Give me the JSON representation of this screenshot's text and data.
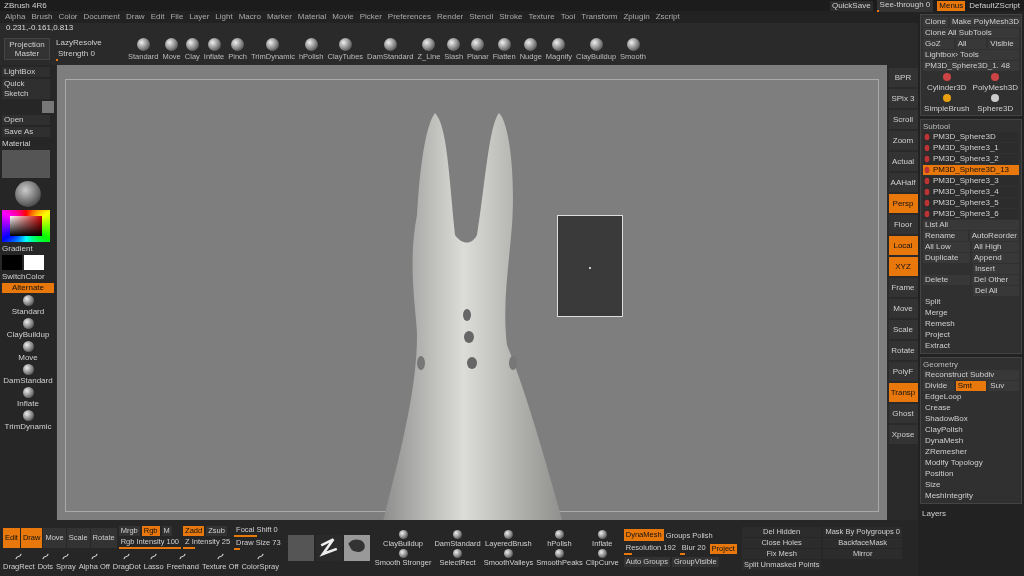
{
  "title_bar": {
    "title": "ZBrush 4R6",
    "quicksave": "QuickSave",
    "see_through": {
      "label": "See-through 0",
      "level": 0.05
    },
    "menus": {
      "label": "Menus",
      "selected": true
    },
    "script": "DefaultZScript"
  },
  "menu": [
    "Alpha",
    "Brush",
    "Color",
    "Document",
    "Draw",
    "Edit",
    "File",
    "Layer",
    "Light",
    "Macro",
    "Marker",
    "Material",
    "Movie",
    "Picker",
    "Preferences",
    "Render",
    "Stencil",
    "Stroke",
    "Texture",
    "Tool",
    "Transform",
    "Zplugin",
    "Zscript"
  ],
  "coords": "0.231,-0.161,0.813",
  "top_shelf": {
    "projection_master": "Projection Master",
    "lazy_header": "LazyResolve",
    "strength": {
      "label": "Strength 0",
      "level": 0.05
    },
    "brushes": [
      "Standard",
      "Move",
      "Clay",
      "Inflate",
      "Pinch",
      "TrimDynamic",
      "hPolish",
      "ClayTubes",
      "DamStandard",
      "Z_Line",
      "Slash",
      "Planar",
      "Flatten",
      "Nudge",
      "Magnify",
      "ClayBuildup",
      "Smooth"
    ]
  },
  "left_tray": {
    "lightbox": "LightBox",
    "quick_sketch": "Quick Sketch",
    "open": "Open",
    "save_as": "Save As",
    "material_label": "Material",
    "gradient": "Gradient",
    "switch_color": "SwitchColor",
    "alternate": {
      "label": "Alternate",
      "selected": true
    },
    "brushes": [
      "Standard",
      "ClayBuildup",
      "Move",
      "DamStandard",
      "Inflate",
      "TrimDynamic"
    ]
  },
  "right_shelf": [
    {
      "label": "BPR",
      "selected": false
    },
    {
      "label": "SPix 3",
      "selected": false
    },
    {
      "label": "Scroll",
      "selected": false
    },
    {
      "label": "Zoom",
      "selected": false
    },
    {
      "label": "Actual",
      "selected": false
    },
    {
      "label": "AAHalf",
      "selected": false
    },
    {
      "label": "Persp",
      "selected": true
    },
    {
      "label": "Floor",
      "selected": false
    },
    {
      "label": "Local",
      "selected": true
    },
    {
      "label": "XYZ",
      "selected": true
    },
    {
      "label": "Frame",
      "selected": false
    },
    {
      "label": "Move",
      "selected": false
    },
    {
      "label": "Scale",
      "selected": false
    },
    {
      "label": "Rotate",
      "selected": false
    },
    {
      "label": "PolyF",
      "selected": false
    },
    {
      "label": "Transp",
      "selected": true
    },
    {
      "label": "Ghost",
      "selected": false
    },
    {
      "label": "Xpose",
      "selected": false
    }
  ],
  "tool_panel": {
    "clone": "Clone",
    "make_polymesh": "Make PolyMesh3D",
    "clone_all": "Clone All SubTools",
    "goz": "GoZ",
    "all": "All",
    "visible": "Visible",
    "lightbox_tools": "Lightbox› Tools",
    "current_tool": "PM3D_Sphere3D_1. 48",
    "thumbs": [
      "Cylinder3D",
      "PolyMesh3D",
      "SimpleBrush",
      "Sphere3D"
    ]
  },
  "subtool": {
    "title": "Subtool",
    "items": [
      {
        "name": "PM3D_Sphere3D",
        "selected": false
      },
      {
        "name": "PM3D_Sphere3_1",
        "selected": false
      },
      {
        "name": "PM3D_Sphere3_2",
        "selected": false
      },
      {
        "name": "PM3D_Sphere3D_13",
        "selected": true
      },
      {
        "name": "PM3D_Sphere3_3",
        "selected": false
      },
      {
        "name": "PM3D_Sphere3_4",
        "selected": false
      },
      {
        "name": "PM3D_Sphere3_5",
        "selected": false
      },
      {
        "name": "PM3D_Sphere3_6",
        "selected": false
      }
    ],
    "list_all": "List All",
    "actions": [
      [
        "Rename",
        "AutoReorder"
      ],
      [
        "All Low",
        "All High"
      ],
      [
        "Duplicate",
        "Append"
      ],
      [
        "Insert"
      ],
      [
        "Delete",
        "Del Other"
      ],
      [
        "Del All"
      ]
    ],
    "more": [
      "Split",
      "Merge",
      "Remesh",
      "Project",
      "Extract"
    ]
  },
  "geometry": {
    "title": "Geometry",
    "reconstruct": "Reconstruct Subdiv",
    "divide": "Divide",
    "smt": {
      "label": "Smt",
      "on": true
    },
    "suv": {
      "label": "Suv",
      "on": false
    },
    "items": [
      "EdgeLoop",
      "Crease",
      "ShadowBox",
      "ClayPolish",
      "DynaMesh",
      "ZRemesher",
      "Modify Topology",
      "Position",
      "Size",
      "MeshIntegrity"
    ]
  },
  "layers": "Layers",
  "bottom_shelf": {
    "modes": [
      {
        "label": "Edit",
        "selected": true
      },
      {
        "label": "Draw",
        "selected": true
      },
      {
        "label": "Move",
        "selected": false
      },
      {
        "label": "Scale",
        "selected": false
      },
      {
        "label": "Rotate",
        "selected": false
      }
    ],
    "color_modes": [
      {
        "label": "Mrgb",
        "selected": false
      },
      {
        "label": "Rgb",
        "selected": true
      },
      {
        "label": "M",
        "selected": false
      }
    ],
    "z_modes": [
      {
        "label": "Zadd",
        "selected": true
      },
      {
        "label": "Zsub",
        "selected": false
      }
    ],
    "sliders": [
      {
        "label": "Rgb Intensity 100",
        "level": 1
      },
      {
        "label": "Z Intensity 25",
        "level": 0.25
      },
      {
        "label": "Focal Shift 0",
        "level": 0.5
      },
      {
        "label": "Draw Size 73",
        "level": 0.12
      }
    ],
    "strokes": [
      "DragRect",
      "Dots",
      "Spray",
      "Alpha Off",
      "DragDot",
      "Lasso",
      "Freehand",
      "Texture Off",
      "ColorSpray"
    ],
    "brush_grid": [
      "ClayBuildup",
      "DamStandard",
      "LayeredBrush",
      "hPolish",
      "Inflate",
      "Smooth Stronger",
      "SelectRect",
      "SmoothValleys",
      "SmoothPeaks",
      "ClipCurve"
    ],
    "dynamesh": {
      "label": "DynaMesh",
      "selected": true
    },
    "resolution": {
      "label": "Resolution 192",
      "level": 0.15
    },
    "groups": "Groups",
    "polish": "Polish",
    "blur": {
      "label": "Blur 20",
      "level": 0.2
    },
    "project": {
      "label": "Project",
      "selected": true
    },
    "auto_groups": "Auto Groups",
    "group_visible": "GroupVisible",
    "right_cmds": [
      "Del Hidden",
      "Mask By Polygroups 0",
      "Close Holes",
      "BackfaceMask",
      "Fix Mesh",
      "Mirror",
      "Split Unmasked Points"
    ]
  }
}
